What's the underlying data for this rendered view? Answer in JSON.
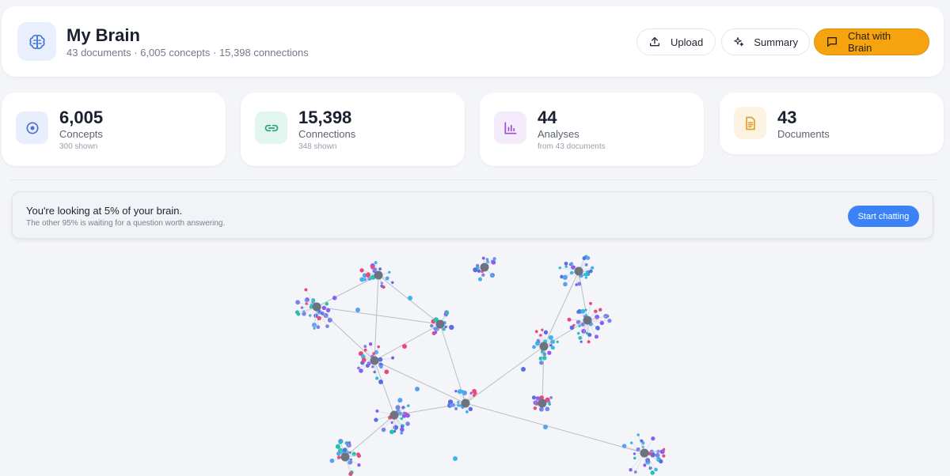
{
  "header": {
    "title": "My Brain",
    "subtitle": "43 documents · 6,005 concepts · 15,398 connections",
    "buttons": {
      "upload": "Upload",
      "summary": "Summary",
      "chat": "Chat with Brain"
    },
    "icons": {
      "brain": "brain-icon",
      "upload": "upload-icon",
      "summary": "sparkles-icon",
      "chat": "chat-bubble-icon"
    }
  },
  "stats": [
    {
      "value": "6,005",
      "label": "Concepts",
      "sub": "300 shown",
      "icon": "target-icon",
      "tile_color": "#e8eefb",
      "icon_color": "#4a6fd8"
    },
    {
      "value": "15,398",
      "label": "Connections",
      "sub": "348 shown",
      "icon": "link-icon",
      "tile_color": "#e3f5ef",
      "icon_color": "#2f9f7c"
    },
    {
      "value": "44",
      "label": "Analyses",
      "sub": "from 43 documents",
      "icon": "bar-chart-icon",
      "tile_color": "#f4ebfb",
      "icon_color": "#9a4fd6"
    },
    {
      "value": "43",
      "label": "Documents",
      "sub": "",
      "icon": "document-icon",
      "tile_color": "#fdf3e1",
      "icon_color": "#e0a12c"
    }
  ],
  "banner": {
    "title": "You're looking at 5% of your brain.",
    "subtitle": "The other 95% is waiting for a question worth answering.",
    "button": "Start chatting"
  },
  "colors": {
    "accent": "#f5a30e",
    "primary_blue": "#3b82f6",
    "hub_node": "#6b7280",
    "node_palette": [
      "#5b6ee1",
      "#7c83e8",
      "#3ab6e8",
      "#22c4b0",
      "#8b5cf6",
      "#e84a7a",
      "#5aa0f0"
    ]
  }
}
